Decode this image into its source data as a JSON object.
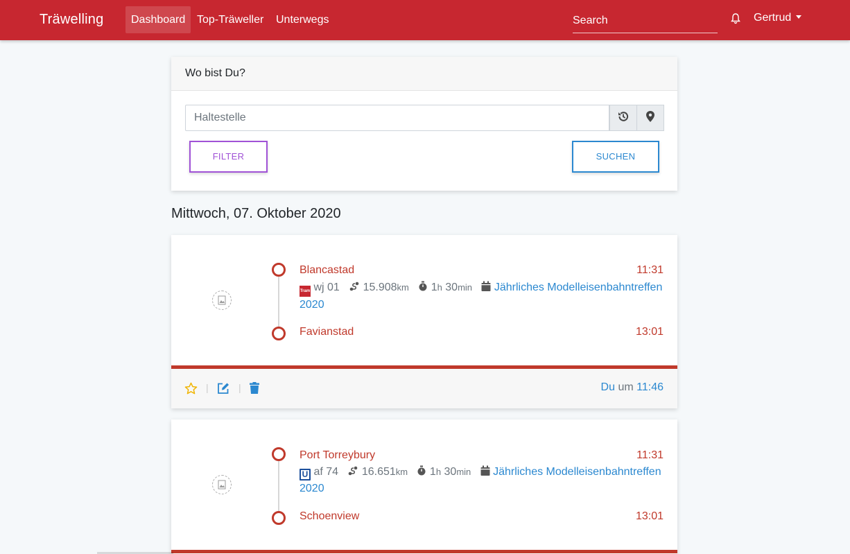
{
  "navbar": {
    "brand": "Träwelling",
    "links": [
      {
        "label": "Dashboard",
        "active": true
      },
      {
        "label": "Top-Träweller",
        "active": false
      },
      {
        "label": "Unterwegs",
        "active": false
      }
    ],
    "search_placeholder": "Search",
    "user_name": "Gertrud",
    "icons": {
      "notifications": "bell-icon",
      "user_menu": "caret-down-icon"
    }
  },
  "search_card": {
    "header": "Wo bist Du?",
    "input_placeholder": "Haltestelle",
    "history_icon": "history-icon",
    "location_icon": "map-marker-icon",
    "filter_label": "FILTER",
    "search_label": "SUCHEN"
  },
  "date_heading": "Mittwoch, 07. Oktober 2020",
  "statuses": [
    {
      "origin": "Blancastad",
      "departure": "11:31",
      "line_type": "Tram",
      "line": "wj 01",
      "distance": "15.908",
      "distance_unit": "km",
      "duration_h": "1",
      "duration_h_unit": "h",
      "duration_min": "30",
      "duration_min_unit": "min",
      "event": "Jährliches Modelleisenbahntreffen 2020",
      "destination": "Favianstad",
      "arrival": "13:01",
      "progress_fraction": 1.0,
      "footer_user": "Du",
      "footer_um": "um",
      "footer_time": "11:46"
    },
    {
      "origin": "Port Torreybury",
      "departure": "11:31",
      "line_type": "U",
      "line": "af 74",
      "distance": "16.651",
      "distance_unit": "km",
      "duration_h": "1",
      "duration_h_unit": "h",
      "duration_min": "30",
      "duration_min_unit": "min",
      "event": "Jährliches Modelleisenbahntreffen 2020",
      "destination": "Schoenview",
      "arrival": "13:01",
      "progress_fraction": 1.0
    }
  ],
  "colors": {
    "brand_red": "#c72730",
    "station_red": "#c0392b",
    "link_blue": "#2b88d0",
    "filter_purple": "#a052d6",
    "star_yellow": "#f0b400"
  }
}
